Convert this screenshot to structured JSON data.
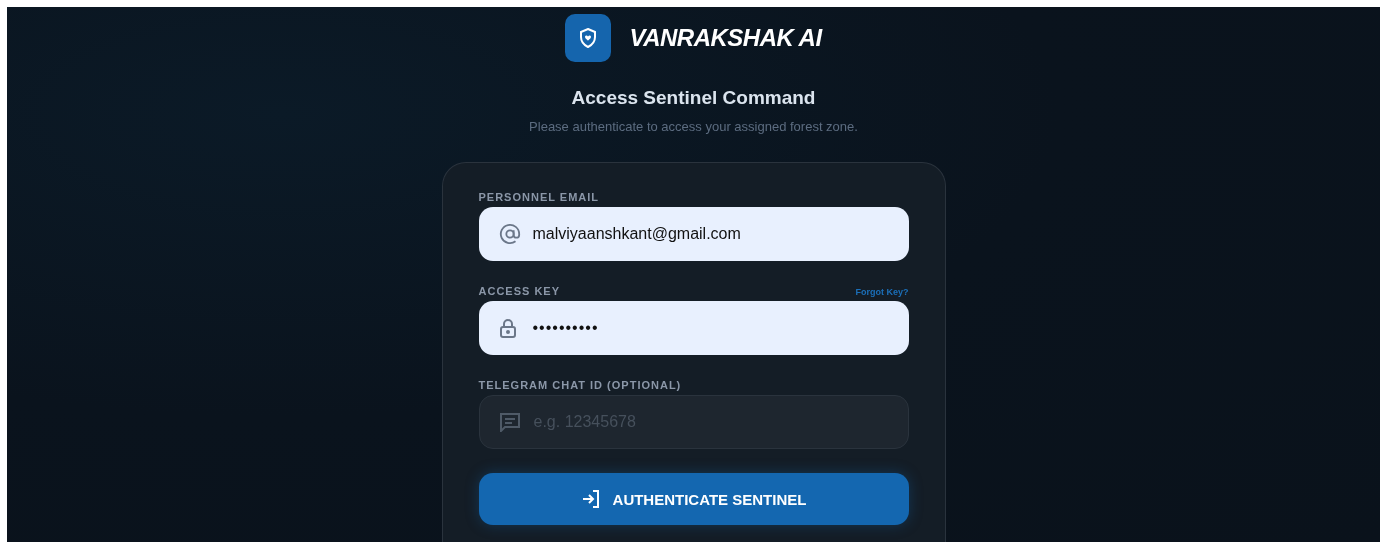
{
  "brand": {
    "name": "VANRAKSHAK AI"
  },
  "heading": {
    "title": "Access Sentinel Command",
    "subtitle": "Please authenticate to access your assigned forest zone."
  },
  "form": {
    "fields": [
      {
        "kind": "email",
        "label": "PERSONNEL EMAIL",
        "value": "malviyaanshkant@gmail.com",
        "filled": true
      },
      {
        "kind": "password",
        "label": "ACCESS KEY",
        "link": "Forgot Key?",
        "value": "••••••••••",
        "filled": true
      },
      {
        "kind": "chat",
        "label": "TELEGRAM CHAT ID (OPTIONAL)",
        "placeholder": "e.g. 12345678",
        "filled": false
      }
    ],
    "submit": "AUTHENTICATE SENTINEL"
  }
}
